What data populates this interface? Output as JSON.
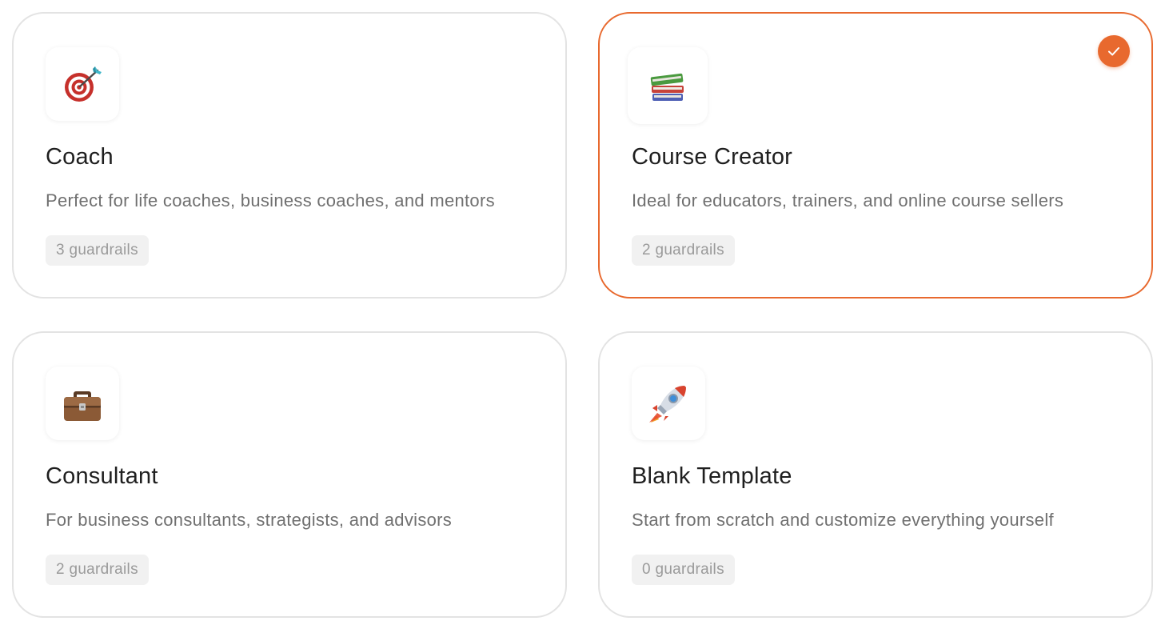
{
  "accent_color": "#e8692e",
  "templates": [
    {
      "icon": "target-icon",
      "title": "Coach",
      "description": "Perfect for life coaches, business coaches, and mentors",
      "badge": "3 guardrails",
      "selected": false
    },
    {
      "icon": "books-icon",
      "title": "Course Creator",
      "description": "Ideal for educators, trainers, and online course sellers",
      "badge": "2 guardrails",
      "selected": true
    },
    {
      "icon": "briefcase-icon",
      "title": "Consultant",
      "description": "For business consultants, strategists, and advisors",
      "badge": "2 guardrails",
      "selected": false
    },
    {
      "icon": "rocket-icon",
      "title": "Blank Template",
      "description": "Start from scratch and customize everything yourself",
      "badge": "0 guardrails",
      "selected": false
    }
  ]
}
